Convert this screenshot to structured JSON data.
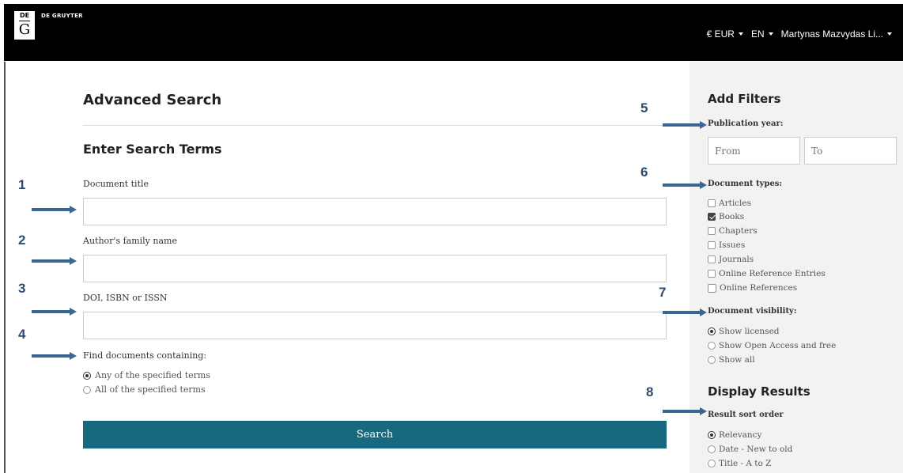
{
  "header": {
    "brand_top": "DE",
    "brand_letter": "G",
    "brand_name": "DE GRUYTER",
    "currency": "€ EUR",
    "language": "EN",
    "user": "Martynas Mazvydas Li..."
  },
  "main": {
    "title": "Advanced Search",
    "subtitle": "Enter Search Terms",
    "fields": {
      "title_label": "Document title",
      "title_value": "",
      "author_label": "Author's family name",
      "author_value": "",
      "doi_label": "DOI, ISBN or ISSN",
      "doi_value": ""
    },
    "find_label": "Find documents containing:",
    "find_options": [
      "Any of the specified terms",
      "All of the specified terms"
    ],
    "find_selected": 0,
    "search_button": "Search"
  },
  "sidebar": {
    "add_filters": "Add Filters",
    "pub_year_label": "Publication year:",
    "from_placeholder": "From",
    "to_placeholder": "To",
    "doc_types_label": "Document types:",
    "doc_types": [
      {
        "label": "Articles",
        "checked": false
      },
      {
        "label": "Books",
        "checked": true
      },
      {
        "label": "Chapters",
        "checked": false
      },
      {
        "label": "Issues",
        "checked": false
      },
      {
        "label": "Journals",
        "checked": false
      },
      {
        "label": "Online Reference Entries",
        "checked": false
      },
      {
        "label": "Online References",
        "checked": false
      }
    ],
    "visibility_label": "Document visibility:",
    "visibility_options": [
      "Show licensed",
      "Show Open Access and free",
      "Show all"
    ],
    "visibility_selected": 0,
    "display_results": "Display Results",
    "sort_label": "Result sort order",
    "sort_options": [
      "Relevancy",
      "Date - New to old",
      "Title - A to Z"
    ],
    "sort_selected": 0
  },
  "annotations": [
    "1",
    "2",
    "3",
    "4",
    "5",
    "6",
    "7",
    "8"
  ],
  "colors": {
    "header_bg": "#000000",
    "button_bg": "#17697f",
    "sidebar_bg": "#f2f2f2",
    "annotation": "#3b6594"
  }
}
